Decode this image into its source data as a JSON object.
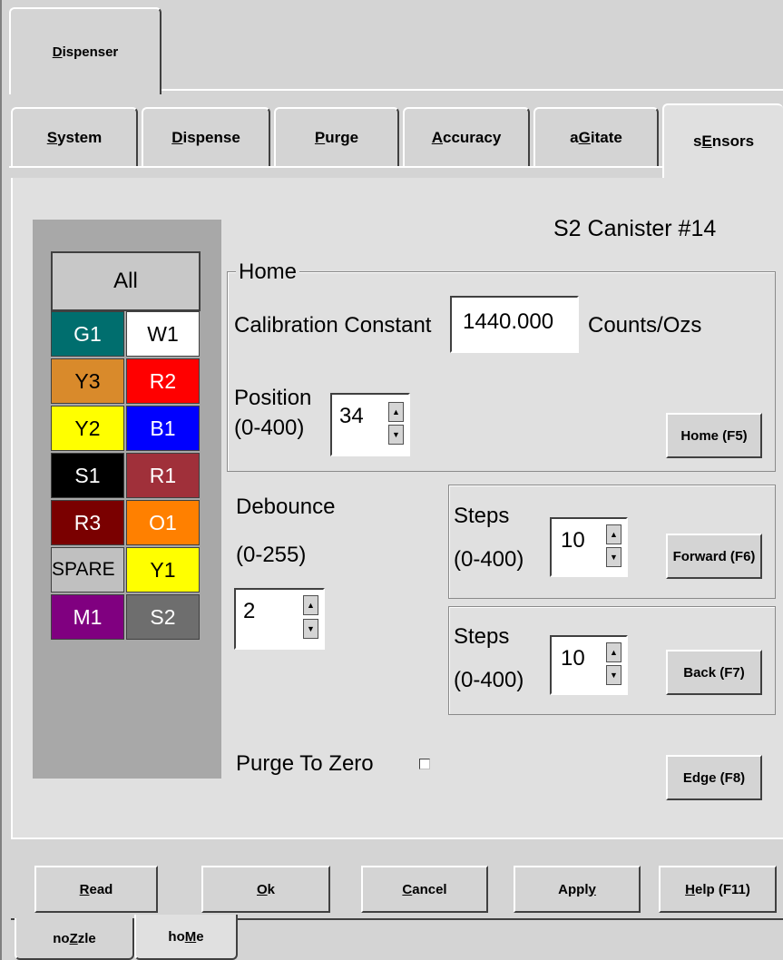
{
  "outer_tabs": [
    {
      "pre": "",
      "key": "D",
      "post": "ispenser"
    }
  ],
  "main_tabs": [
    {
      "pre": "",
      "key": "S",
      "post": "ystem"
    },
    {
      "pre": "",
      "key": "D",
      "post": "ispense"
    },
    {
      "pre": "",
      "key": "P",
      "post": "urge"
    },
    {
      "pre": "",
      "key": "A",
      "post": "ccuracy"
    },
    {
      "pre": "a",
      "key": "G",
      "post": "itate"
    },
    {
      "pre": "s",
      "key": "E",
      "post": "nsors"
    }
  ],
  "title": "S2 Canister #14",
  "canisters": {
    "all_label": "All",
    "cells": [
      {
        "label": "G1",
        "bg": "#006e6e",
        "fg": "#ffffff"
      },
      {
        "label": "W1",
        "bg": "#ffffff",
        "fg": "#000000"
      },
      {
        "label": "Y3",
        "bg": "#d98a2b",
        "fg": "#000000"
      },
      {
        "label": "R2",
        "bg": "#ff0000",
        "fg": "#ffffff"
      },
      {
        "label": "Y2",
        "bg": "#ffff00",
        "fg": "#000000"
      },
      {
        "label": "B1",
        "bg": "#0000ff",
        "fg": "#ffffff"
      },
      {
        "label": "S1",
        "bg": "#000000",
        "fg": "#ffffff"
      },
      {
        "label": "R1",
        "bg": "#a0303a",
        "fg": "#ffffff"
      },
      {
        "label": "R3",
        "bg": "#7a0000",
        "fg": "#ffffff"
      },
      {
        "label": "O1",
        "bg": "#ff8000",
        "fg": "#ffffff"
      },
      {
        "label": "SPARE",
        "bg": "#c0c0c0",
        "fg": "#000000"
      },
      {
        "label": "Y1",
        "bg": "#ffff00",
        "fg": "#000000"
      },
      {
        "label": "M1",
        "bg": "#800080",
        "fg": "#ffffff"
      },
      {
        "label": "S2",
        "bg": "#6e6e6e",
        "fg": "#ffffff"
      }
    ]
  },
  "home": {
    "group_label": "Home",
    "cal_label": "Calibration Constant",
    "cal_value": "1440.000",
    "cal_units": "Counts/Ozs",
    "position_label": "Position",
    "position_range": "(0-400)",
    "position_value": "34",
    "home_button": "Home (F5)"
  },
  "debounce": {
    "label": "Debounce",
    "range": "(0-255)",
    "value": "2"
  },
  "forward": {
    "label": "Steps",
    "range": "(0-400)",
    "value": "10",
    "button": "Forward (F6)"
  },
  "back": {
    "label": "Steps",
    "range": "(0-400)",
    "value": "10",
    "button": "Back (F7)"
  },
  "purge_to_zero": {
    "label": "Purge To Zero",
    "checked": false
  },
  "edge_button": "Edge (F8)",
  "bottom_buttons": [
    {
      "pre": "",
      "key": "R",
      "post": "ead"
    },
    {
      "pre": "",
      "key": "O",
      "post": "k"
    },
    {
      "pre": "",
      "key": "C",
      "post": "ancel"
    },
    {
      "pre": "Appl",
      "key": "y",
      "post": ""
    },
    {
      "pre": "",
      "key": "H",
      "post": "elp (F11)"
    }
  ],
  "bottom_tabs": [
    {
      "pre": "no",
      "key": "Z",
      "post": "zle"
    },
    {
      "pre": "ho",
      "key": "M",
      "post": "e"
    }
  ],
  "colors": {
    "face": "#d4d4d4",
    "highlight": "#ffffff",
    "shadow": "#404040"
  }
}
